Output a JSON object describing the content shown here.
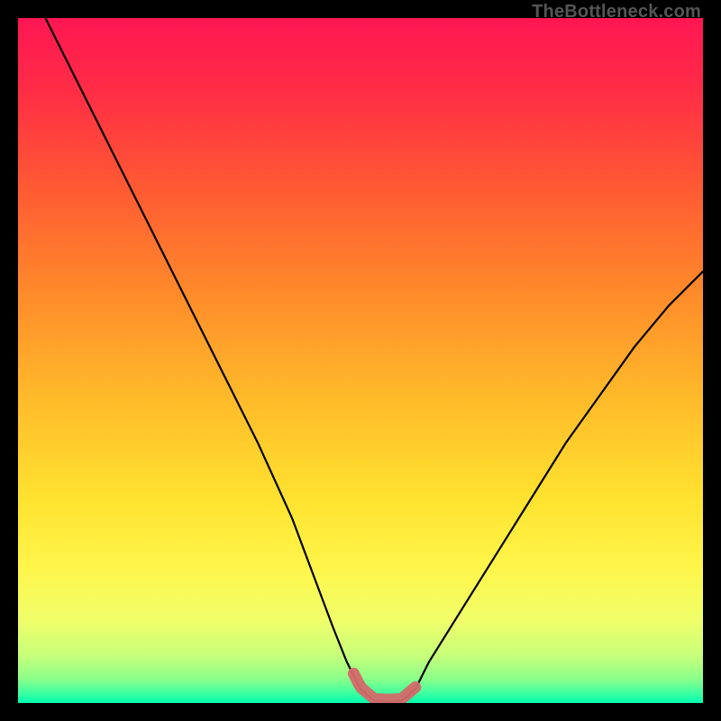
{
  "watermark": "TheBottleneck.com",
  "colors": {
    "frame": "#000000",
    "watermark_text": "#555555",
    "gradient_stops": [
      {
        "offset": 0.0,
        "color": "#ff1653"
      },
      {
        "offset": 0.1,
        "color": "#ff2b46"
      },
      {
        "offset": 0.25,
        "color": "#ff5a33"
      },
      {
        "offset": 0.4,
        "color": "#ff8a2a"
      },
      {
        "offset": 0.55,
        "color": "#ffb92a"
      },
      {
        "offset": 0.7,
        "color": "#ffe22f"
      },
      {
        "offset": 0.8,
        "color": "#fff54a"
      },
      {
        "offset": 0.88,
        "color": "#f0ff6a"
      },
      {
        "offset": 0.93,
        "color": "#c8ff7a"
      },
      {
        "offset": 0.965,
        "color": "#8aff8a"
      },
      {
        "offset": 0.985,
        "color": "#40ffa0"
      },
      {
        "offset": 1.0,
        "color": "#00ffb0"
      }
    ],
    "curve_stroke": "#000000",
    "marker_fill": "#d46a6a",
    "marker_stroke": "#d46a6a"
  },
  "chart_data": {
    "type": "line",
    "title": "",
    "xlabel": "",
    "ylabel": "",
    "xlim": [
      0,
      100
    ],
    "ylim": [
      0,
      100
    ],
    "grid": false,
    "series": [
      {
        "name": "bottleneck-curve",
        "x": [
          4,
          10,
          15,
          20,
          25,
          30,
          35,
          40,
          43,
          46,
          48,
          50,
          52,
          54,
          56,
          58,
          60,
          65,
          70,
          75,
          80,
          85,
          90,
          95,
          100
        ],
        "values": [
          100,
          88,
          78,
          68,
          58,
          48,
          38,
          27,
          19,
          11,
          6,
          2,
          0.3,
          0.2,
          0.3,
          2,
          6,
          14,
          22,
          30,
          38,
          45,
          52,
          58,
          63
        ]
      }
    ],
    "annotations": [
      {
        "name": "optimal-zone-marker",
        "type": "highlight-segment",
        "x_range": [
          49,
          58
        ],
        "y_near": 0.5
      }
    ]
  }
}
